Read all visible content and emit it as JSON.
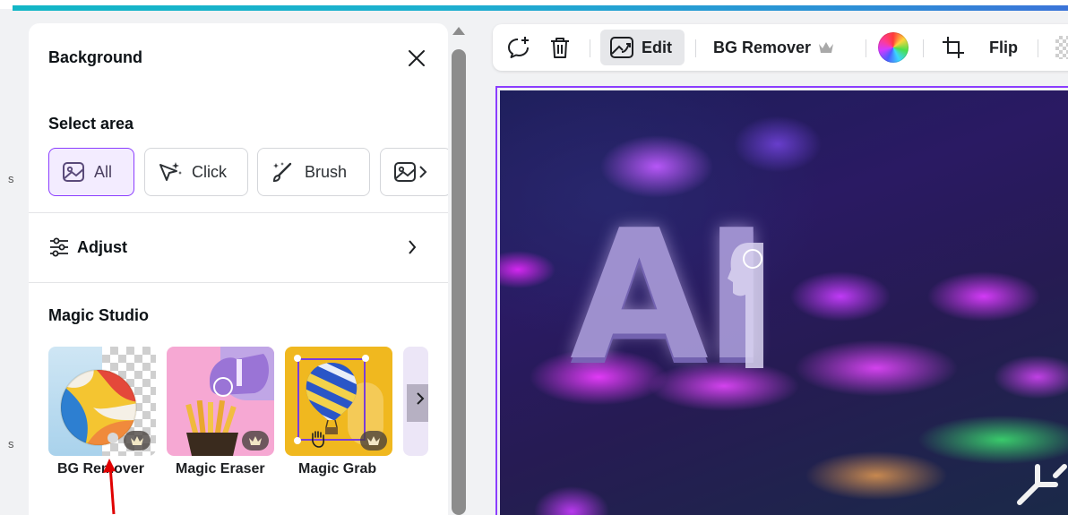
{
  "panel": {
    "title": "Background",
    "select_area_label": "Select area",
    "area_options": [
      {
        "label": "All",
        "selected": true
      },
      {
        "label": "Click",
        "selected": false
      },
      {
        "label": "Brush",
        "selected": false
      }
    ],
    "adjust_label": "Adjust",
    "magic_studio_label": "Magic Studio",
    "tools": [
      {
        "label": "BG Remover",
        "premium": true
      },
      {
        "label": "Magic Eraser",
        "premium": true
      },
      {
        "label": "Magic Grab",
        "premium": true
      }
    ]
  },
  "toolbar": {
    "edit_label": "Edit",
    "bg_remover_label": "BG Remover",
    "flip_label": "Flip"
  },
  "canvas": {
    "image_text": "AI"
  },
  "sidebar_fragments": [
    "s",
    "s"
  ],
  "colors": {
    "accent": "#8b3dff",
    "top_bar": "#13b6c6",
    "annotation_arrow": "#e00000"
  }
}
